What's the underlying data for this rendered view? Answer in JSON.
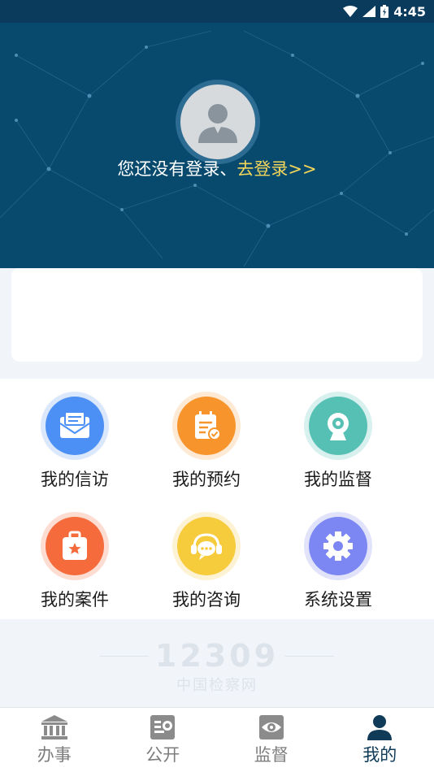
{
  "status_bar": {
    "time": "4:45"
  },
  "header": {
    "login_prompt": "您还没有登录、",
    "login_link": "去登录>>"
  },
  "grid": {
    "items": [
      {
        "label": "我的信访",
        "icon": "envelope-icon",
        "color": "#4c8ff5",
        "halo": "#dbe8fb"
      },
      {
        "label": "我的预约",
        "icon": "calendar-check-icon",
        "color": "#f7952c",
        "halo": "#fde9d4"
      },
      {
        "label": "我的监督",
        "icon": "webcam-icon",
        "color": "#57c0b4",
        "halo": "#d8f1ee"
      },
      {
        "label": "我的案件",
        "icon": "case-icon",
        "color": "#f56b3c",
        "halo": "#fddcd2"
      },
      {
        "label": "我的咨询",
        "icon": "chat-headset-icon",
        "color": "#f7cc3c",
        "halo": "#fdf3d4"
      },
      {
        "label": "系统设置",
        "icon": "gear-icon",
        "color": "#7c87f3",
        "halo": "#e1e3fb"
      }
    ]
  },
  "watermark": {
    "number": "12309",
    "text": "中国检察网"
  },
  "tabs": [
    {
      "label": "办事",
      "icon": "bank-icon",
      "active": false
    },
    {
      "label": "公开",
      "icon": "document-icon",
      "active": false
    },
    {
      "label": "监督",
      "icon": "eye-icon",
      "active": false
    },
    {
      "label": "我的",
      "icon": "user-icon",
      "active": true
    }
  ],
  "colors": {
    "header_bg": "#074a6e",
    "link": "#f3d55a",
    "tab_active": "#0f3a58",
    "tab_inactive": "#7d7d7d"
  }
}
